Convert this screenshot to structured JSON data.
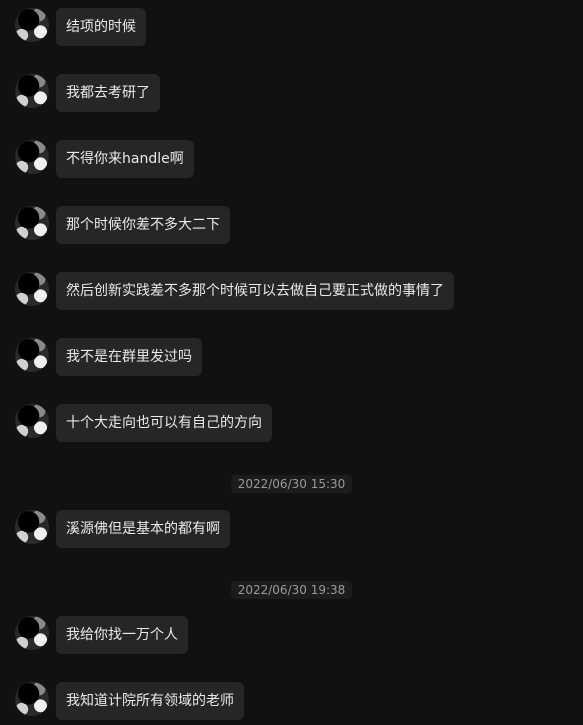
{
  "messages": [
    {
      "text": "结项的时候"
    },
    {
      "text": "我都去考研了"
    },
    {
      "text": "不得你来handle啊"
    },
    {
      "text": "那个时候你差不多大二下"
    },
    {
      "text": "然后创新实践差不多那个时候可以去做自己要正式做的事情了"
    },
    {
      "text": "我不是在群里发过吗"
    },
    {
      "text": "十个大走向也可以有自己的方向"
    },
    {
      "text": "溪源佛但是基本的都有啊"
    },
    {
      "text": "我给你找一万个人"
    },
    {
      "text": "我知道计院所有领域的老师"
    }
  ],
  "timestamps": [
    {
      "text": "2022/06/30 15:30"
    },
    {
      "text": "2022/06/30 19:38"
    }
  ]
}
